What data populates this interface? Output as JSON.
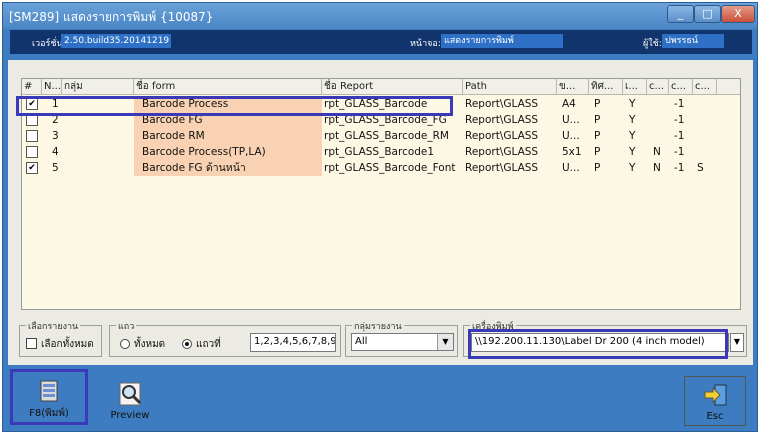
{
  "window": {
    "title": "[SM289] แสดงรายการพิมพ์ {10087}",
    "min_label": "_",
    "max_label": "□",
    "close_label": "X"
  },
  "infobar": {
    "version_label": "เวอร์ชั่น:",
    "version_value": "2.50.build35.20141219",
    "screen_label": "หน้าจอ:",
    "screen_value": "แสดงรายการพิมพ์",
    "user_label": "ผู้ใช้:",
    "user_value": "ปพรรธน์"
  },
  "grid": {
    "headers": [
      "#",
      "N...",
      "กลุ่ม",
      "ชื่อ form",
      "ชื่อ Report",
      "Path",
      "ข...",
      "ทิศ...",
      "เ...",
      "c...",
      "c...",
      "c..."
    ],
    "rows": [
      {
        "checked": true,
        "check_mark": "✔",
        "n": "1",
        "group": "",
        "form": "Barcode Process",
        "report": "rpt_GLASS_Barcode",
        "path": "Report\\GLASS",
        "c1": "A4",
        "c2": "P",
        "c3": "Y",
        "c4": "",
        "c5": "-1",
        "c6": ""
      },
      {
        "checked": false,
        "check_mark": "",
        "n": "2",
        "group": "",
        "form": "Barcode FG",
        "report": "rpt_GLASS_Barcode_FG",
        "path": "Report\\GLASS",
        "c1": "U...",
        "c2": "P",
        "c3": "Y",
        "c4": "",
        "c5": "-1",
        "c6": ""
      },
      {
        "checked": false,
        "check_mark": "",
        "n": "3",
        "group": "",
        "form": "Barcode RM",
        "report": "rpt_GLASS_Barcode_RM",
        "path": "Report\\GLASS",
        "c1": "U...",
        "c2": "P",
        "c3": "Y",
        "c4": "",
        "c5": "-1",
        "c6": ""
      },
      {
        "checked": false,
        "check_mark": "",
        "n": "4",
        "group": "",
        "form": "Barcode Process(TP,LA)",
        "report": "rpt_GLASS_Barcode1",
        "path": "Report\\GLASS",
        "c1": "5x1",
        "c2": "P",
        "c3": "Y",
        "c4": "N",
        "c5": "-1",
        "c6": ""
      },
      {
        "checked": true,
        "check_mark": "✔",
        "n": "5",
        "group": "",
        "form": "Barcode FG ด้านหน้า",
        "report": "rpt_GLASS_Barcode_Font",
        "path": "Report\\GLASS",
        "c1": "U...",
        "c2": "P",
        "c3": "Y",
        "c4": "N",
        "c5": "-1",
        "c6": "S"
      }
    ]
  },
  "filters": {
    "select_group_label": "เลือกรายงาน",
    "select_all_label": "เลือกทั้งหมด",
    "rows_group_label": "แถว",
    "radio_all_label": "ทั้งหมด",
    "radio_rows_label": "แถวที่",
    "rows_value": "1,2,3,4,5,6,7,8,9,",
    "report_group_label": "กลุ่มรายงาน",
    "report_group_value": "All",
    "printer_group_label": "เครื่องพิมพ์",
    "printer_value": "\\\\192.200.11.130\\Label Dr 200 (4 inch model)",
    "dropdown_arrow": "▼"
  },
  "actions": {
    "print_label": "F8(พิมพ์)",
    "preview_label": "Preview",
    "esc_label": "Esc"
  },
  "colors": {
    "window_blue": "#3d7cc0",
    "info_navy": "#12346d",
    "highlight_border": "#3a3ab8",
    "form_cell": "#f8d2b2",
    "grid_bg": "#fdf8e4"
  }
}
